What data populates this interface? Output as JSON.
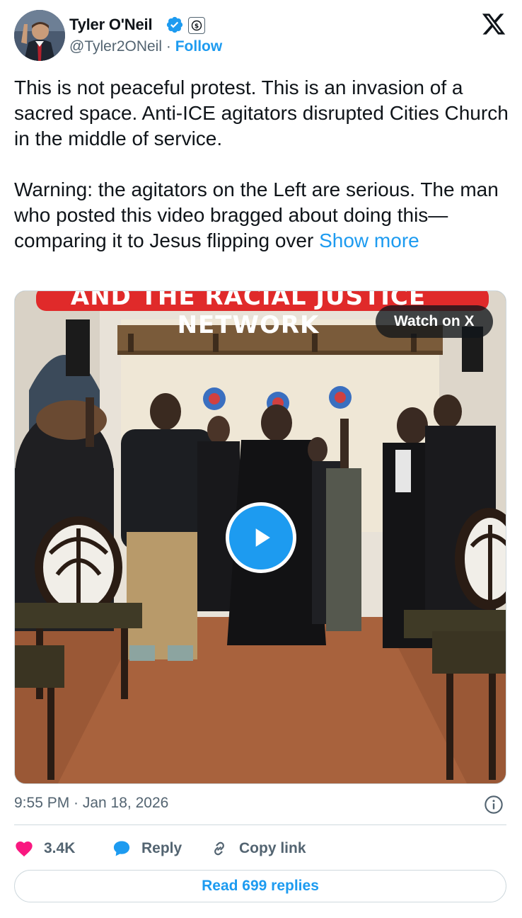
{
  "author": {
    "name": "Tyler O'Neil",
    "handle": "@Tyler2ONeil",
    "separator": "·",
    "follow_label": "Follow"
  },
  "tweet": {
    "paragraph1": "This is not peaceful protest. This is an invasion of a sacred space. Anti-ICE agitators disrupted Cities Church in the middle of service.",
    "paragraph2": "Warning: the agitators on the Left are serious. The man who posted this video bragged about doing this—comparing it to Jesus flipping over",
    "show_more": "Show more"
  },
  "media": {
    "banner_text": "AND THE RACIAL JUSTICE NETWORK",
    "watch_label": "Watch on X"
  },
  "footer": {
    "timestamp": "9:55 PM · Jan 18, 2026",
    "likes": "3.4K",
    "reply_label": "Reply",
    "copy_link_label": "Copy link",
    "read_replies_label": "Read 699 replies"
  },
  "colors": {
    "accent": "#1d9bf0",
    "like": "#f91880",
    "text": "#0f1419",
    "secondary": "#536471"
  },
  "icons": [
    "verified-badge-icon",
    "affiliate-badge-icon",
    "x-logo-icon",
    "play-icon",
    "info-icon",
    "heart-icon",
    "reply-bubble-icon",
    "link-icon"
  ]
}
